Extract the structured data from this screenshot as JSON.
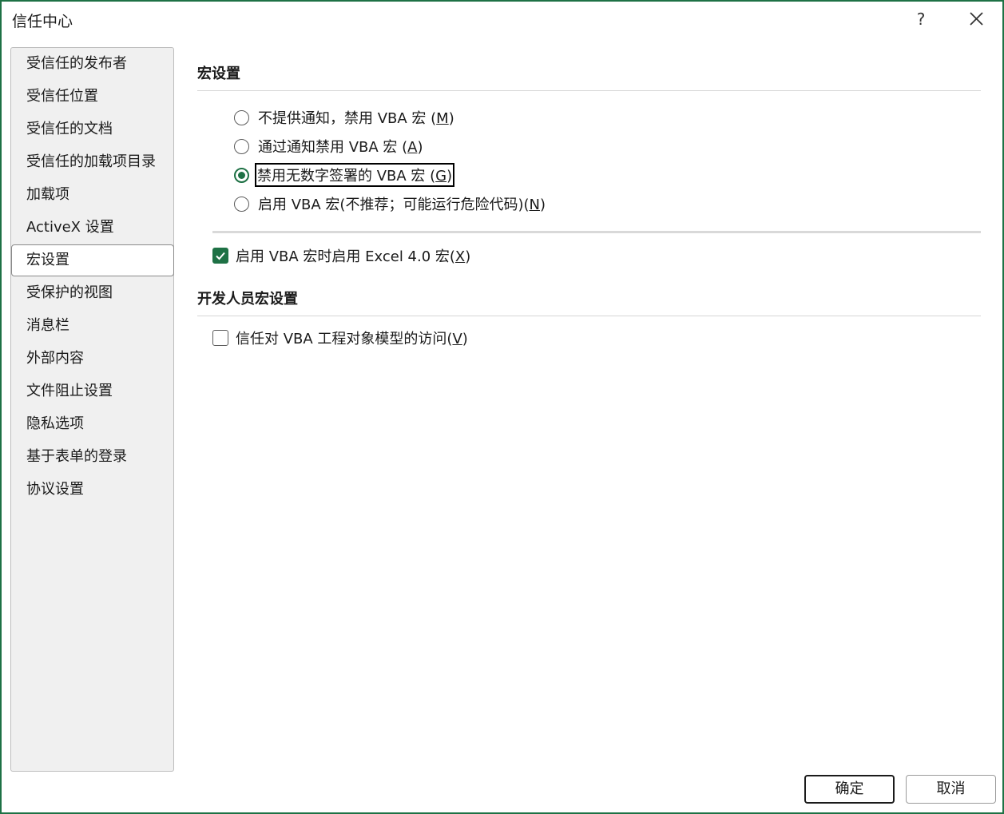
{
  "window": {
    "title": "信任中心",
    "help_label": "?",
    "accent_color": "#1e7145"
  },
  "sidebar": {
    "items": [
      {
        "label": "受信任的发布者",
        "selected": false
      },
      {
        "label": "受信任位置",
        "selected": false
      },
      {
        "label": "受信任的文档",
        "selected": false
      },
      {
        "label": "受信任的加载项目录",
        "selected": false
      },
      {
        "label": "加载项",
        "selected": false
      },
      {
        "label": "ActiveX 设置",
        "selected": false
      },
      {
        "label": "宏设置",
        "selected": true
      },
      {
        "label": "受保护的视图",
        "selected": false
      },
      {
        "label": "消息栏",
        "selected": false
      },
      {
        "label": "外部内容",
        "selected": false
      },
      {
        "label": "文件阻止设置",
        "selected": false
      },
      {
        "label": "隐私选项",
        "selected": false
      },
      {
        "label": "基于表单的登录",
        "selected": false
      },
      {
        "label": "协议设置",
        "selected": false
      }
    ]
  },
  "macro_settings": {
    "heading": "宏设置",
    "options": [
      {
        "text": "不提供通知，禁用 VBA 宏 (",
        "key": "M",
        "suffix": ")",
        "checked": false,
        "focused": false
      },
      {
        "text": "通过通知禁用 VBA 宏 (",
        "key": "A",
        "suffix": ")",
        "checked": false,
        "focused": false
      },
      {
        "text": "禁用无数字签署的 VBA 宏 (",
        "key": "G",
        "suffix": ")",
        "checked": true,
        "focused": true
      },
      {
        "text": "启用 VBA 宏(不推荐；可能运行危险代码)(",
        "key": "N",
        "suffix": ")",
        "checked": false,
        "focused": false
      }
    ],
    "excel4_checkbox": {
      "text": "启用 VBA 宏时启用 Excel 4.0 宏(",
      "key": "X",
      "suffix": ")",
      "checked": true
    }
  },
  "developer_settings": {
    "heading": "开发人员宏设置",
    "vba_access_checkbox": {
      "text": "信任对 VBA 工程对象模型的访问(",
      "key": "V",
      "suffix": ")",
      "checked": false
    }
  },
  "footer": {
    "ok_label": "确定",
    "cancel_label": "取消"
  },
  "icons": {
    "close": "close-icon",
    "checkmark": "checkmark-icon"
  }
}
